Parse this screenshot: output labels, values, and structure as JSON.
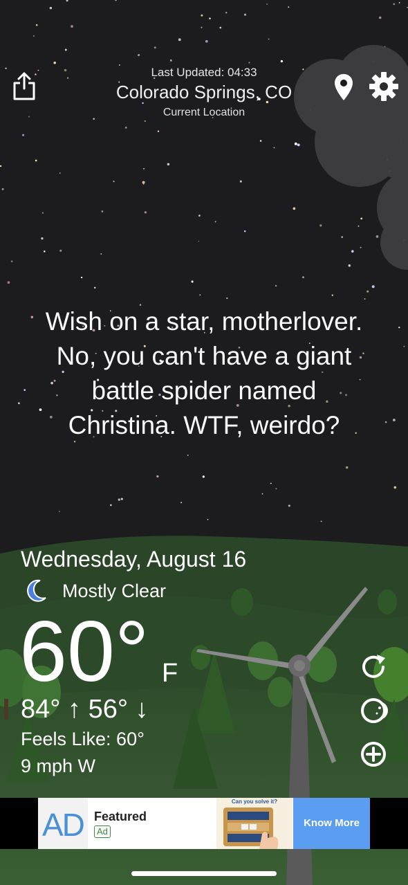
{
  "header": {
    "last_updated": "Last Updated: 04:33",
    "location": "Colorado Springs, CO",
    "sub_location": "Current Location",
    "icons": [
      "share-icon",
      "location-pin-icon",
      "gear-icon"
    ]
  },
  "quote": {
    "line1": "Wish on a star, motherlover.",
    "line2": "No, you can't have a giant",
    "line3": "battle spider named",
    "line4": "Christina. WTF, weirdo?"
  },
  "weather": {
    "date": "Wednesday, August 16",
    "condition": "Mostly Clear",
    "condition_icon": "moon-icon",
    "temperature": "60°",
    "unit": "F",
    "hi_lo": "84° ↑ 56° ↓",
    "feels_like": "Feels Like: 60°",
    "wind": "9 mph W"
  },
  "side_actions": [
    "refresh-icon",
    "theme-toggle-icon",
    "add-icon"
  ],
  "ad": {
    "logo": "AD",
    "featured": "Featured",
    "badge": "Ad",
    "game_title": "Can you solve it?",
    "cta": "Know More"
  },
  "colors": {
    "sky": "#1c1c1e",
    "grass": "#2f4a2b",
    "ad_button": "#5b9df0",
    "moon": "#4a7fe0"
  }
}
